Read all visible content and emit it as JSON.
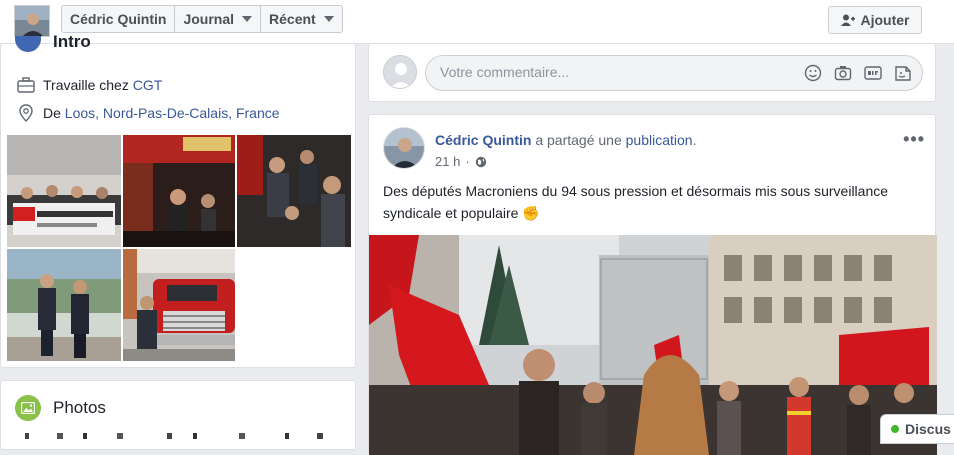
{
  "header": {
    "name": "Cédric Quintin",
    "journal_label": "Journal",
    "recent_label": "Récent",
    "add_button": "Ajouter"
  },
  "intro": {
    "title": "Intro",
    "work_prefix": "Travaille chez ",
    "work_org": "CGT",
    "location_prefix": "De ",
    "location_link": "Loos, Nord-Pas-De-Calais, France"
  },
  "photos_section": {
    "title": "Photos"
  },
  "comment_box": {
    "placeholder": "Votre commentaire..."
  },
  "post": {
    "author": "Cédric Quintin",
    "shared_text": " a partagé une ",
    "shared_link": "publication",
    "shared_end": ".",
    "time": "21 h",
    "more": "•••",
    "text": "Des députés Macroniens du 94 sous pression et désormais mis sous surveillance syndicale et populaire ✊"
  },
  "chat": {
    "label": "Discus"
  },
  "colors": {
    "link": "#385898",
    "accent": "#4267b2",
    "online": "#42b72a"
  }
}
